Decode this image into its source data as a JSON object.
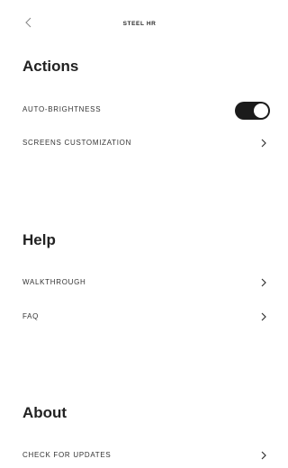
{
  "header": {
    "title": "STEEL HR",
    "back_icon": "back-arrow-icon"
  },
  "sections": [
    {
      "title": "Actions",
      "items": [
        {
          "label": "AUTO-BRIGHTNESS",
          "control": "toggle",
          "toggle_on": true
        },
        {
          "label": "SCREENS CUSTOMIZATION",
          "control": "chevron",
          "icon": "chevron-right-icon"
        }
      ]
    },
    {
      "title": "Help",
      "items": [
        {
          "label": "WALKTHROUGH",
          "control": "chevron",
          "icon": "chevron-right-icon"
        },
        {
          "label": "FAQ",
          "control": "chevron",
          "icon": "chevron-right-icon"
        }
      ]
    },
    {
      "title": "About",
      "items": [
        {
          "label": "CHECK FOR UPDATES",
          "control": "chevron",
          "icon": "chevron-right-icon"
        }
      ]
    }
  ],
  "colors": {
    "background": "#ffffff",
    "text": "#222222",
    "toggle_on": "#1b1b1b"
  }
}
